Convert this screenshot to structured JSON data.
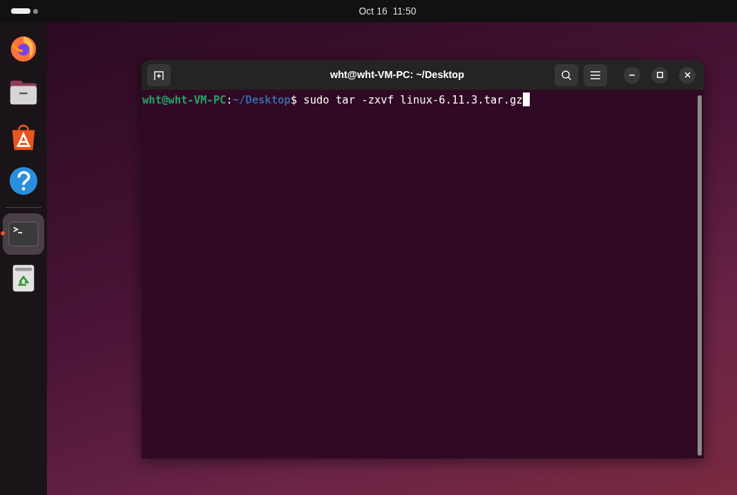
{
  "top_bar": {
    "workspaces": [
      {
        "selected": true
      },
      {
        "selected": false
      }
    ],
    "clock": "Oct 16  11:50"
  },
  "dock": {
    "items": [
      {
        "kind": "browser",
        "active": false
      },
      {
        "kind": "files",
        "active": false
      },
      {
        "kind": "store",
        "active": false
      },
      {
        "kind": "help",
        "active": false
      },
      {
        "kind": "terminal",
        "active": true
      },
      {
        "kind": "trash",
        "active": false
      }
    ]
  },
  "terminal": {
    "title": "wht@wht-VM-PC: ~/Desktop",
    "prompt": [
      {
        "kind": "user",
        "text": "wht@wht-VM-PC"
      },
      {
        "kind": "plain",
        "text": ":"
      },
      {
        "kind": "path",
        "text": "~/Desktop"
      },
      {
        "kind": "plain",
        "text": "$ "
      },
      {
        "kind": "command",
        "text": "sudo tar -zxvf linux-6.11.3.tar.gz"
      }
    ],
    "cursor": true
  }
}
